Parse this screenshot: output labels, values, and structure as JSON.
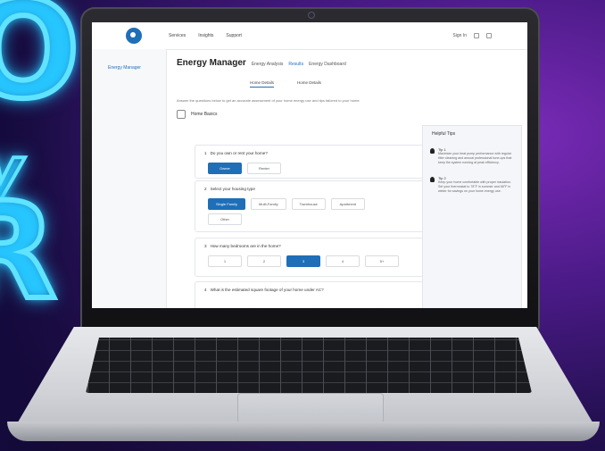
{
  "app": {
    "nav": [
      "Services",
      "Insights",
      "Support"
    ],
    "sign_in": "Sign In"
  },
  "sidebar": {
    "items": [
      "Energy Manager"
    ]
  },
  "page": {
    "title": "Energy Manager",
    "crumbs": [
      "Energy Analysis",
      "Results",
      "Energy Dashboard"
    ],
    "steps": [
      "Home Details",
      "Home Details"
    ],
    "intro": "Answer the questions below to get an accurate assessment of your home energy use and tips tailored to your home.",
    "section": "Home Basics"
  },
  "questions": [
    {
      "num": "1",
      "text": "Do you own or rent your home?",
      "options": [
        "Owner",
        "Renter"
      ],
      "selected": 0
    },
    {
      "num": "2",
      "text": "Select your housing type",
      "options": [
        "Single Family",
        "Multi-Family",
        "Townhouse",
        "Apartment",
        "Other"
      ],
      "selected": 0
    },
    {
      "num": "3",
      "text": "How many bedrooms are in the home?",
      "options": [
        "1",
        "2",
        "3",
        "4",
        "5+"
      ],
      "selected": 2
    },
    {
      "num": "4",
      "text": "What is the estimated square footage of your home under AC?",
      "options": [],
      "selected": -1
    }
  ],
  "tips": {
    "title": "Helpful Tips",
    "items": [
      {
        "title": "Tip 1",
        "body": "Maximize your heat pump performance with regular filter cleaning and annual professional tune-ups that keep the system running at peak efficiency."
      },
      {
        "title": "Tip 2",
        "body": "Keep your home comfortable with proper insulation. Set your thermostat to 78°F in summer and 68°F in winter for savings on your home energy use."
      }
    ]
  }
}
